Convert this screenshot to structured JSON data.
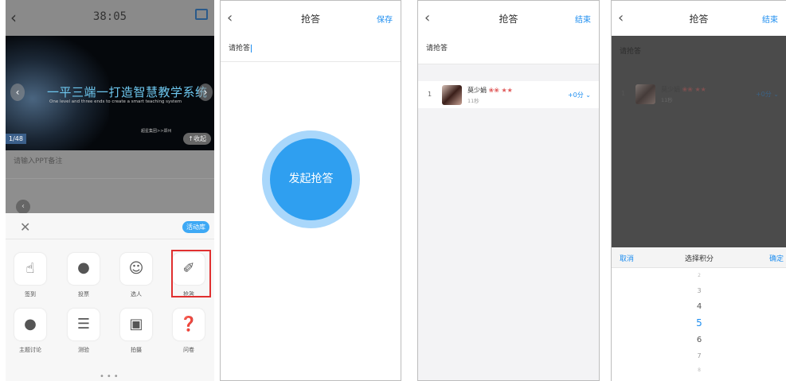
{
  "screen1": {
    "back_icon": "chevron-left",
    "time": "38:05",
    "share_icon": "share-icon",
    "slide": {
      "title": "一平三端一打造智慧教学系统",
      "subtitle": "One level and three ends to create a smart teaching system",
      "small_text": "超星集团>>郑州",
      "page_indicator": "1/48",
      "collapse_label": "↑收起"
    },
    "note_placeholder": "请输入PPT备注",
    "activity_lib_label": "活动库",
    "tools": [
      {
        "label": "签到",
        "icon": "tap-icon"
      },
      {
        "label": "投票",
        "icon": "chart-icon"
      },
      {
        "label": "选人",
        "icon": "user-check-icon"
      },
      {
        "label": "抢答",
        "icon": "microphone-icon",
        "highlighted": true
      },
      {
        "label": "主题讨论",
        "icon": "chat-icon"
      },
      {
        "label": "测验",
        "icon": "quiz-icon"
      },
      {
        "label": "拍摄",
        "icon": "camera-icon"
      },
      {
        "label": "问卷",
        "icon": "questionnaire-icon"
      }
    ]
  },
  "screen2": {
    "title": "抢答",
    "action": "保存",
    "question": "请抢答",
    "start_button": "发起抢答"
  },
  "screen3": {
    "title": "抢答",
    "action": "结束",
    "question": "请抢答",
    "answers": [
      {
        "rank": "1",
        "name": "莫少娟",
        "badges": "❀❀ ★★",
        "time": "11秒",
        "score": "+0分 ⌄"
      }
    ]
  },
  "screen4": {
    "title": "抢答",
    "action": "结束",
    "question": "请抢答",
    "answers": [
      {
        "rank": "1",
        "name": "莫少娟",
        "badges": "❀❀ ★★",
        "time": "11秒",
        "score": "+0分 ⌄"
      }
    ],
    "picker": {
      "cancel": "取消",
      "title": "选择积分",
      "confirm": "确定",
      "options": [
        "2",
        "3",
        "4",
        "5",
        "6",
        "7",
        "8"
      ],
      "selected": "5"
    }
  },
  "colors": {
    "accent": "#1e8ef0",
    "button": "#2f9ff0",
    "button_ring": "#a9d7fb",
    "highlight": "#e03030"
  }
}
